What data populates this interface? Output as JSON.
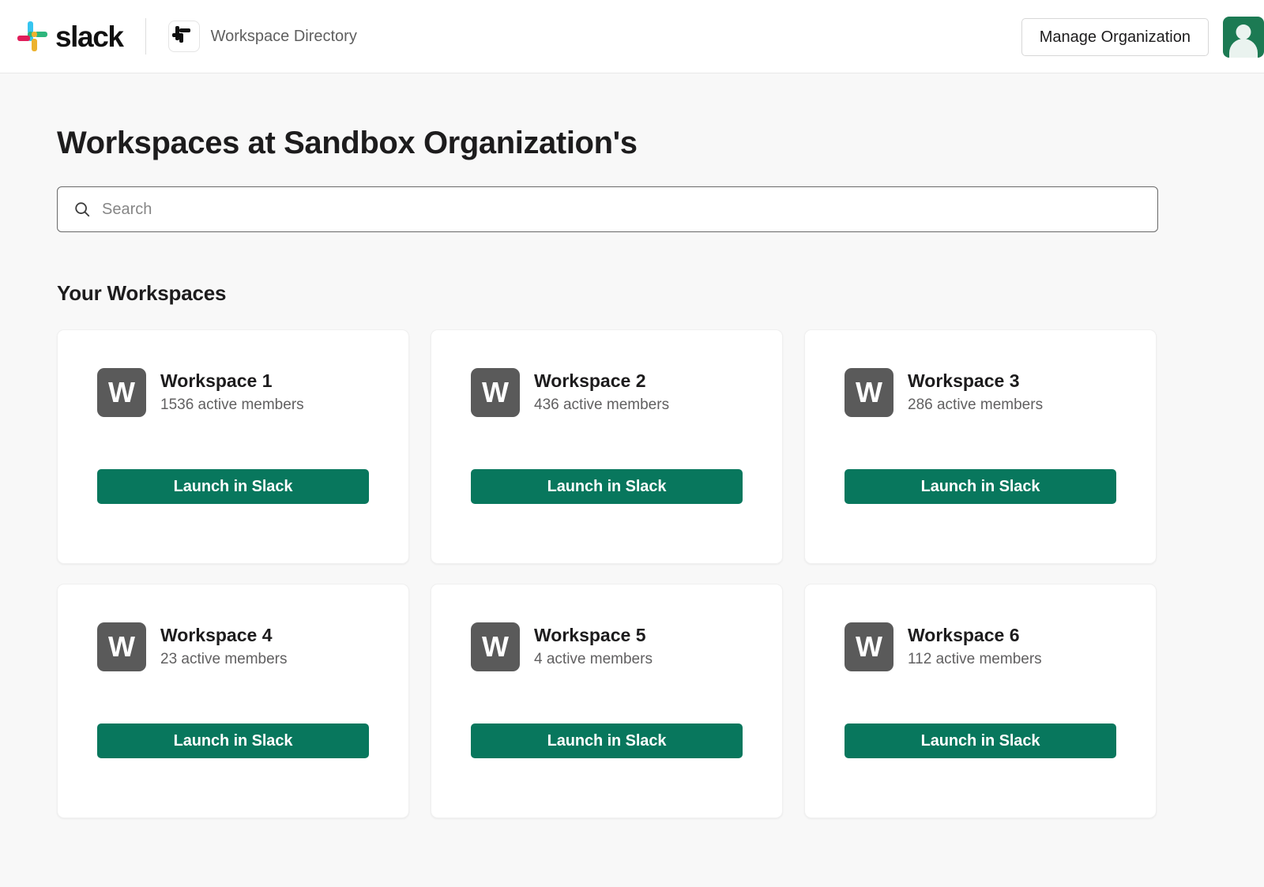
{
  "header": {
    "brand_name": "slack",
    "brand_logo_icon": "slack-logo-icon",
    "directory_icon": "slack-hash-icon",
    "directory_label": "Workspace Directory",
    "manage_button_label": "Manage Organization",
    "avatar_icon": "user-avatar-icon",
    "avatar_color": "#1c7a53"
  },
  "main": {
    "page_title": "Workspaces at Sandbox Organization's",
    "search": {
      "icon": "search-icon",
      "placeholder": "Search",
      "value": ""
    },
    "section_title": "Your Workspaces",
    "launch_button_label": "Launch in Slack",
    "launch_button_color": "#08775d",
    "workspace_avatar_letter": "W",
    "workspace_avatar_color": "#5a5a5a",
    "workspaces": [
      {
        "name": "Workspace 1",
        "members": "1536 active members",
        "avatar_letter": "W",
        "launch_label": "Launch in Slack"
      },
      {
        "name": "Workspace 2",
        "members": "436 active members",
        "avatar_letter": "W",
        "launch_label": "Launch in Slack"
      },
      {
        "name": "Workspace 3",
        "members": "286 active members",
        "avatar_letter": "W",
        "launch_label": "Launch in Slack"
      },
      {
        "name": "Workspace 4",
        "members": "23 active members",
        "avatar_letter": "W",
        "launch_label": "Launch in Slack"
      },
      {
        "name": "Workspace 5",
        "members": "4 active members",
        "avatar_letter": "W",
        "launch_label": "Launch in Slack"
      },
      {
        "name": "Workspace 6",
        "members": "112 active members",
        "avatar_letter": "W",
        "launch_label": "Launch in Slack"
      }
    ]
  }
}
